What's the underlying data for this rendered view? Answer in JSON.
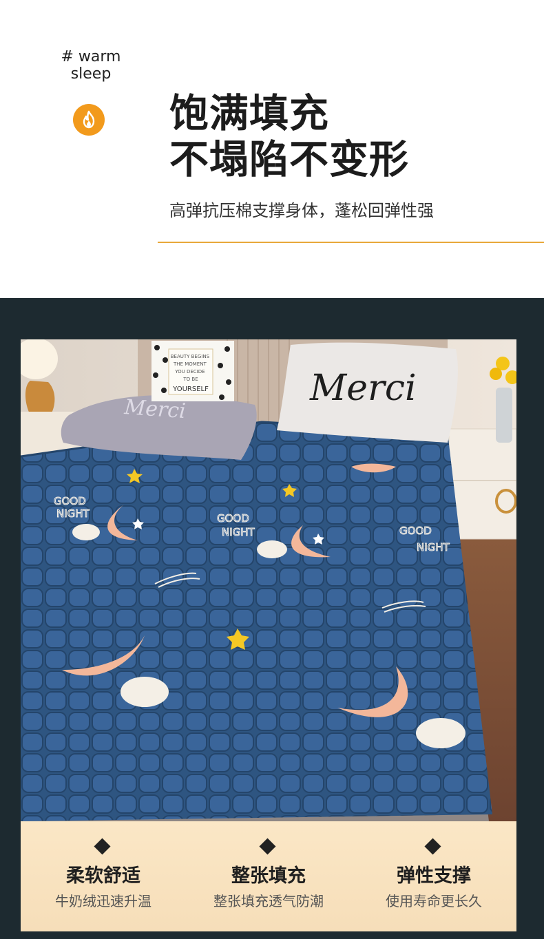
{
  "header": {
    "hashtag": "# warm\nsleep",
    "hashtag_line1": "# warm",
    "hashtag_line2": "sleep",
    "badge_icon": "flame-icon",
    "headline_line1": "饱满填充",
    "headline_line2": "不塌陷不变形",
    "subline": "高弹抗压棉支撑身体，蓬松回弹性强",
    "accent_color": "#e8a83a",
    "badge_color": "#f29a1c"
  },
  "photo": {
    "pillow_left_text": "Merci",
    "pillow_right_text": "Merci",
    "cushion_lines": [
      "BEAUTY BEGINS",
      "THE MOMENT",
      "YOU DECIDE",
      "TO BE",
      "YOURSELF"
    ],
    "mattress_text_line1": "GOOD",
    "mattress_text_line2": "NIGHT",
    "mattress_color": "#2e5581"
  },
  "features": [
    {
      "icon": "diamond-icon",
      "title": "柔软舒适",
      "subtitle": "牛奶绒迅速升温"
    },
    {
      "icon": "diamond-icon",
      "title": "整张填充",
      "subtitle": "整张填充透气防潮"
    },
    {
      "icon": "diamond-icon",
      "title": "弹性支撑",
      "subtitle": "使用寿命更长久"
    }
  ]
}
